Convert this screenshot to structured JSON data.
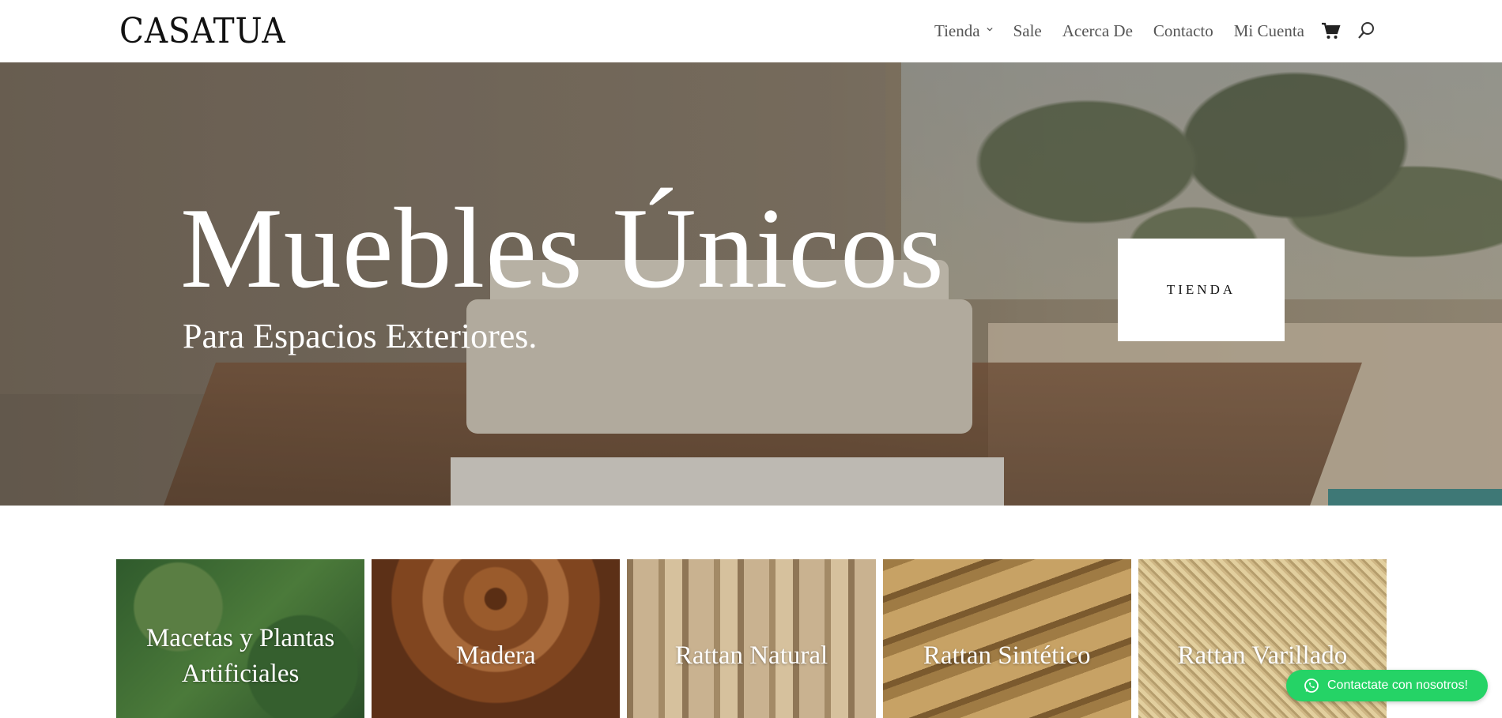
{
  "header": {
    "logo": "CASATUA",
    "nav": [
      {
        "label": "Tienda",
        "has_dropdown": true
      },
      {
        "label": "Sale"
      },
      {
        "label": "Acerca De"
      },
      {
        "label": "Contacto"
      },
      {
        "label": "Mi Cuenta"
      }
    ],
    "icons": [
      "cart-icon",
      "search-icon"
    ]
  },
  "hero": {
    "headline": "Muebles Únicos",
    "subheadline": "Para Espacios Exteriores.",
    "button_label": "TIENDA"
  },
  "categories": [
    {
      "title": "Macetas y Plantas Artificiales"
    },
    {
      "title": "Madera"
    },
    {
      "title": "Rattan Natural"
    },
    {
      "title": "Rattan Sintético"
    },
    {
      "title": "Rattan Varillado"
    }
  ],
  "whatsapp": {
    "label": "Contactate con nosotros!",
    "color": "#25d366"
  }
}
